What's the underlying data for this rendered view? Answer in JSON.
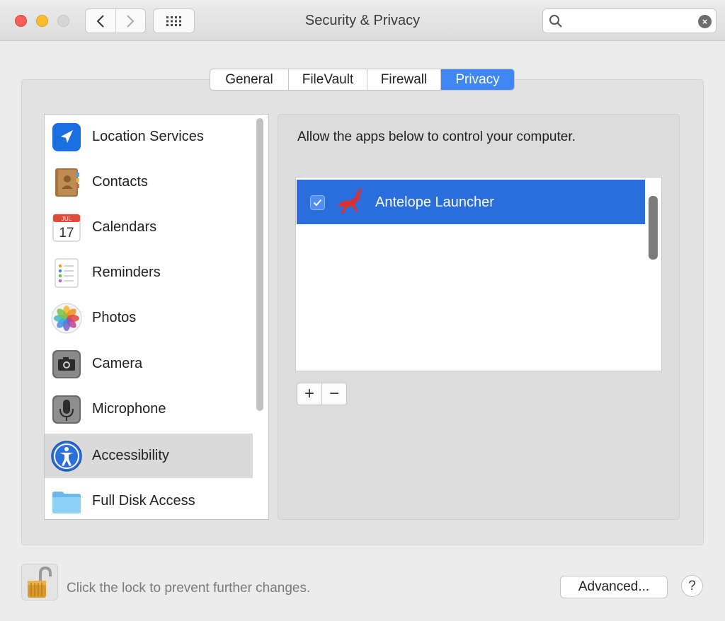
{
  "window": {
    "title": "Security & Privacy",
    "search_value": "",
    "clear_glyph": "×"
  },
  "tabs": [
    {
      "label": "General"
    },
    {
      "label": "FileVault"
    },
    {
      "label": "Firewall"
    },
    {
      "label": "Privacy",
      "active": true
    }
  ],
  "sidebar": {
    "items": [
      {
        "label": "Location Services",
        "icon": "location-arrow-icon"
      },
      {
        "label": "Contacts",
        "icon": "contacts-book-icon"
      },
      {
        "label": "Calendars",
        "icon": "calendar-icon",
        "icon_month": "JUL",
        "icon_day": "17"
      },
      {
        "label": "Reminders",
        "icon": "reminders-icon"
      },
      {
        "label": "Photos",
        "icon": "photos-flower-icon"
      },
      {
        "label": "Camera",
        "icon": "camera-icon"
      },
      {
        "label": "Microphone",
        "icon": "microphone-icon"
      },
      {
        "label": "Accessibility",
        "icon": "accessibility-icon",
        "selected": true
      },
      {
        "label": "Full Disk Access",
        "icon": "folder-icon"
      }
    ]
  },
  "main": {
    "description": "Allow the apps below to control your computer.",
    "apps": [
      {
        "name": "Antelope Launcher",
        "checked": true,
        "icon": "antelope-icon"
      }
    ],
    "add_label": "+",
    "remove_label": "−"
  },
  "footer": {
    "lock_text": "Click the lock to prevent further changes.",
    "advanced_label": "Advanced...",
    "help_label": "?"
  },
  "colors": {
    "accent": "#3f87f5",
    "selection": "#2a6ddc",
    "window_bg": "#ececec"
  }
}
